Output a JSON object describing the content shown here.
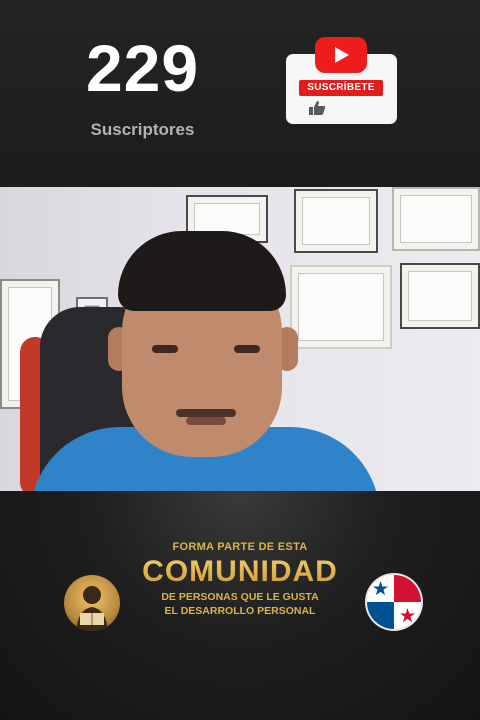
{
  "header": {
    "subscriber_count": "229",
    "subscriber_label": "Suscriptores",
    "subscribe_button_label": "SUSCRÍBETE"
  },
  "icons": {
    "youtube": "youtube-logo-icon",
    "like": "thumbs-up-icon",
    "avatar": "reading-person-avatar",
    "flag": "panama-flag-icon"
  },
  "colors": {
    "youtube_red": "#ee1d1d",
    "promo_gold": "#d9b34a",
    "shirt_blue": "#2f84c9"
  },
  "promo": {
    "line1": "FORMA PARTE DE ESTA",
    "line2": "COMUNIDAD",
    "line3": "DE PERSONAS QUE LE GUSTA",
    "line4": "EL DESARROLLO PERSONAL"
  }
}
